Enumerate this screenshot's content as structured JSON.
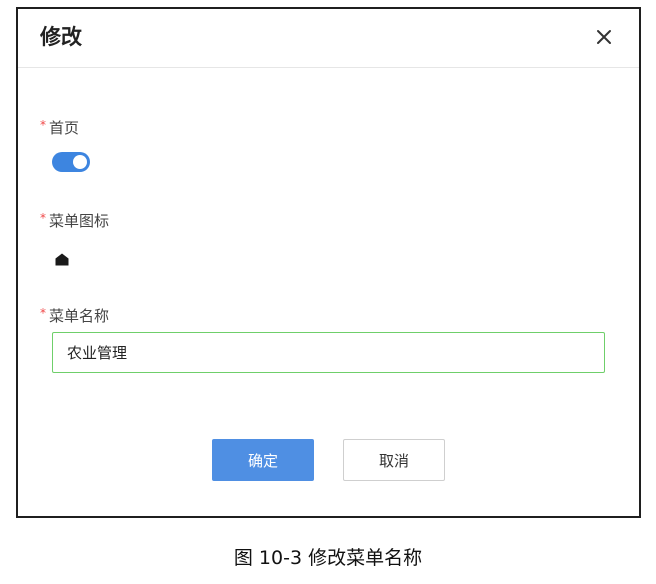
{
  "dialog": {
    "title": "修改",
    "close_icon": "close-icon",
    "fields": {
      "homepage": {
        "required_mark": "*",
        "label": "首页",
        "toggle_on": true
      },
      "menu_icon": {
        "required_mark": "*",
        "label": "菜单图标",
        "icon": "home-icon"
      },
      "menu_name": {
        "required_mark": "*",
        "label": "菜单名称",
        "value": "农业管理"
      }
    },
    "buttons": {
      "confirm": "确定",
      "cancel": "取消"
    }
  },
  "caption": "图  10-3  修改菜单名称",
  "colors": {
    "accent": "#3d85e0",
    "confirm_button": "#4f8fe3",
    "input_border_focus": "#6fcf6a",
    "required": "#f04848"
  }
}
